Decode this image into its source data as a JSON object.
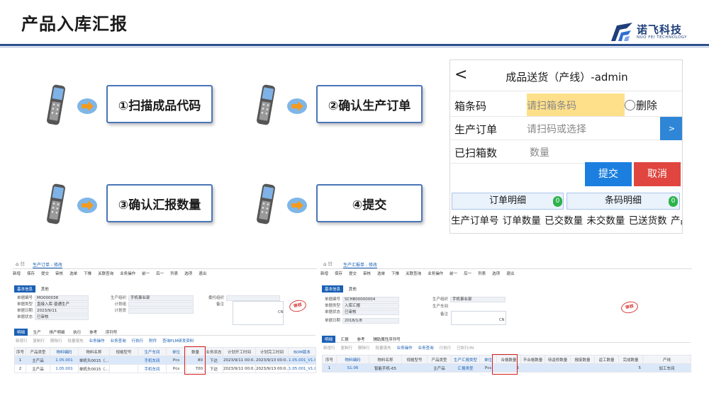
{
  "slide": {
    "title": "产品入库汇报"
  },
  "logo": {
    "name_cn": "诺飞科技",
    "name_en": "NUO FEI TECHNOLOGY"
  },
  "steps": [
    {
      "label": "①扫描成品代码"
    },
    {
      "label": "②确认生产订单"
    },
    {
      "label": "③确认汇报数量"
    },
    {
      "label": "④提交"
    }
  ],
  "colors": {
    "accent": "#2b4f8e",
    "submit": "#1c7fe0",
    "cancel": "#e0453f",
    "highlight_input": "#ffe08a",
    "badge": "#2cb34a"
  },
  "mobile": {
    "back": "<",
    "title": "成品送货（产线）-admin",
    "rows": [
      {
        "label": "箱条码",
        "placeholder": "请扫箱条码"
      },
      {
        "label": "生产订单",
        "placeholder": "请扫码或选择"
      },
      {
        "label": "已扫箱数",
        "placeholder": "数量"
      }
    ],
    "delete_label": "删除",
    "select_button": ">",
    "submit": "提交",
    "cancel": "取消",
    "tabs": [
      {
        "label": "订单明细",
        "badge": "0"
      },
      {
        "label": "条码明细",
        "badge": "0"
      }
    ],
    "columns": [
      "生产订单号",
      "订单数量",
      "已交数量",
      "未交数量",
      "已送货数",
      "产品编"
    ]
  },
  "erp_left": {
    "tab": "生产订单 - 修改",
    "toolbar": [
      "新增",
      "保存",
      "提交",
      "审核",
      "选单",
      "下推",
      "关联查询",
      "业务操作",
      "前一",
      "后一",
      "列表",
      "选项",
      "退出"
    ],
    "section_tabs": [
      "基本信息",
      "其他"
    ],
    "fields": [
      {
        "label": "单据编号",
        "value": "MO000038"
      },
      {
        "label": "单据类型",
        "value": "直接入库-普通生产"
      },
      {
        "label": "单据日期",
        "value": "2023/9/11"
      },
      {
        "label": "单据状态",
        "value": "已审核"
      },
      {
        "label": "生产组织",
        "value": "手机事业部"
      },
      {
        "label": "计划组",
        "value": ""
      },
      {
        "label": "计划员",
        "value": ""
      },
      {
        "label": "委托组织",
        "value": ""
      },
      {
        "label": "备注",
        "value": ""
      }
    ],
    "cn": "CN",
    "stamp": "审核",
    "sub_tabs": [
      "明细",
      "生产",
      "排产明细",
      "执行",
      "参考",
      "序列号"
    ],
    "sub_tools": [
      "新增行",
      "复制行",
      "删除行",
      "批量填充",
      "业务操作",
      "业务查询",
      "行执行",
      "附件",
      "查询PLM研发资料"
    ],
    "columns": [
      "序号",
      "产品类型",
      "物料编码",
      "物料名称",
      "规格型号",
      "生产车间",
      "单位",
      "数量",
      "业务状态",
      "计划开工时间",
      "计划完工时间",
      "BOM版本"
    ],
    "rows": [
      [
        "1",
        "主产品",
        "1.05.001",
        "单机头0015（...",
        "",
        "手机车间",
        "Pcs",
        "80",
        "下达",
        "2023/9/11 00:0...",
        "2023/9/13 00:0...",
        "1.05.001_V1.0"
      ],
      [
        "2",
        "主产品",
        "1.05.001",
        "单机头0015（...",
        "",
        "手机车间",
        "Pcs",
        "700",
        "下达",
        "2023/9/11 00:0...",
        "2023/9/13 00:0...",
        "1.05.001_V1.0"
      ]
    ]
  },
  "erp_right": {
    "tab": "生产汇报单 - 修改",
    "toolbar": [
      "新增",
      "保存",
      "提交",
      "审核",
      "选单",
      "下推",
      "关联查询",
      "业务操作",
      "前一",
      "后一",
      "列表",
      "选项",
      "退出"
    ],
    "section_tabs": [
      "基本信息",
      "其他"
    ],
    "fields": [
      {
        "label": "单据编号",
        "value": "SCHB00000004"
      },
      {
        "label": "单据类型",
        "value": "入库汇报"
      },
      {
        "label": "单据状态",
        "value": "已审核"
      },
      {
        "label": "单据日期",
        "value": "2018/1/8"
      },
      {
        "label": "生产组织",
        "value": "手机事业部"
      },
      {
        "label": "生产车间",
        "value": ""
      },
      {
        "label": "备注",
        "value": ""
      }
    ],
    "cn": "CN",
    "stamp": "审核",
    "sub_tabs": [
      "明细",
      "汇报",
      "参考",
      "辅助属性序列号"
    ],
    "sub_tools": [
      "新增行",
      "复制行",
      "删除行",
      "批量填充",
      "业务操作",
      "业务查询",
      "行执行",
      "已执行/IN"
    ],
    "columns": [
      "序号",
      "物料编码",
      "物料名称",
      "规格型号",
      "产品类型",
      "生产汇报类型",
      "单位",
      "合格数量",
      "不合格数量",
      "待返修数量",
      "报废数量",
      "返工数量",
      "完成数量",
      "产线"
    ],
    "rows": [
      [
        "1",
        "S1.06",
        "智能手机-65",
        "",
        "主产品",
        "汇报类型",
        "Pcs",
        "5",
        "",
        "",
        "",
        "",
        "5",
        "加工车间"
      ]
    ]
  }
}
